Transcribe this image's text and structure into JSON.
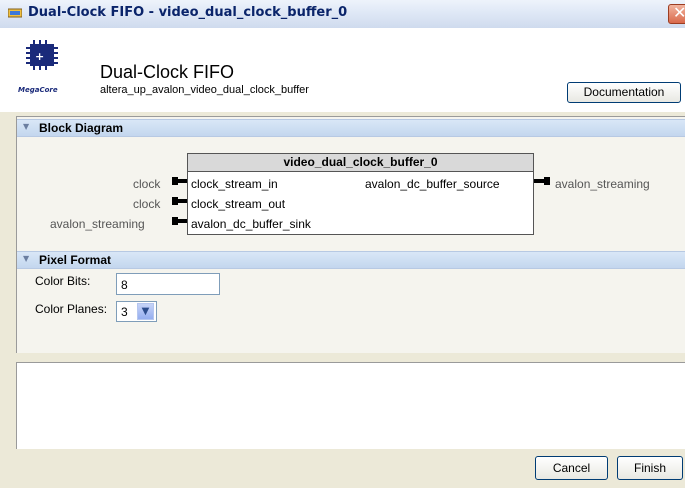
{
  "window": {
    "title": "Dual-Clock FIFO - video_dual_clock_buffer_0"
  },
  "header": {
    "logo_text": "MegaCore",
    "title": "Dual-Clock FIFO",
    "subtitle": "altera_up_avalon_video_dual_clock_buffer",
    "documentation_label": "Documentation"
  },
  "sections": {
    "block_diagram": "Block Diagram",
    "pixel_format": "Pixel Format"
  },
  "block": {
    "name": "video_dual_clock_buffer_0",
    "left_ports": [
      {
        "external": "clock",
        "internal": "clock_stream_in"
      },
      {
        "external": "clock",
        "internal": "clock_stream_out"
      },
      {
        "external": "avalon_streaming",
        "internal": "avalon_dc_buffer_sink"
      }
    ],
    "right_ports": [
      {
        "internal": "avalon_dc_buffer_source",
        "external": "avalon_streaming"
      }
    ]
  },
  "pixel_format": {
    "color_bits_label": "Color Bits:",
    "color_bits_value": "8",
    "color_planes_label": "Color Planes:",
    "color_planes_value": "3"
  },
  "footer": {
    "cancel_label": "Cancel",
    "finish_label": "Finish"
  },
  "colors": {
    "titlebar_text": "#0a246a",
    "section_header": "#c3d6ee",
    "close_button": "#d9694b"
  }
}
